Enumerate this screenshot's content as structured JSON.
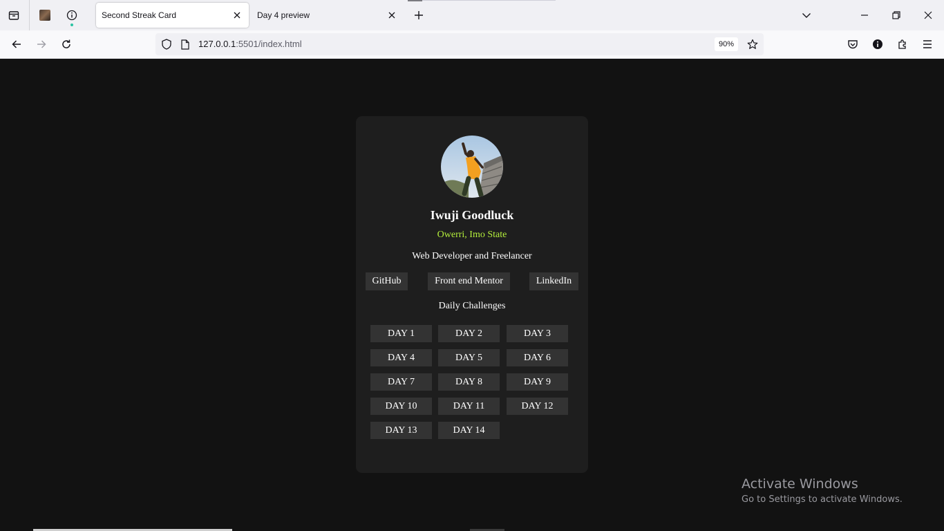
{
  "browser": {
    "tabs": [
      {
        "title": "Second Streak Card",
        "active": true
      },
      {
        "title": "Day 4 preview",
        "active": false
      }
    ],
    "url": {
      "host": "127.0.0.1",
      "rest": ":5501/index.html"
    },
    "zoom": "90%"
  },
  "profile": {
    "name": "Iwuji Goodluck",
    "location": "Owerri, Imo State",
    "bio": "Web Developer and Freelancer",
    "location_color": "#b5f03c",
    "links": [
      {
        "label": "GitHub"
      },
      {
        "label": "Front end Mentor"
      },
      {
        "label": "LinkedIn"
      }
    ],
    "challenges_title": "Daily Challenges",
    "days": [
      "DAY 1",
      "DAY 2",
      "DAY 3",
      "DAY 4",
      "DAY 5",
      "DAY 6",
      "DAY 7",
      "DAY 8",
      "DAY 9",
      "DAY 10",
      "DAY 11",
      "DAY 12",
      "DAY 13",
      "DAY 14"
    ]
  },
  "watermark": {
    "title": "Activate Windows",
    "subtitle": "Go to Settings to activate Windows."
  }
}
